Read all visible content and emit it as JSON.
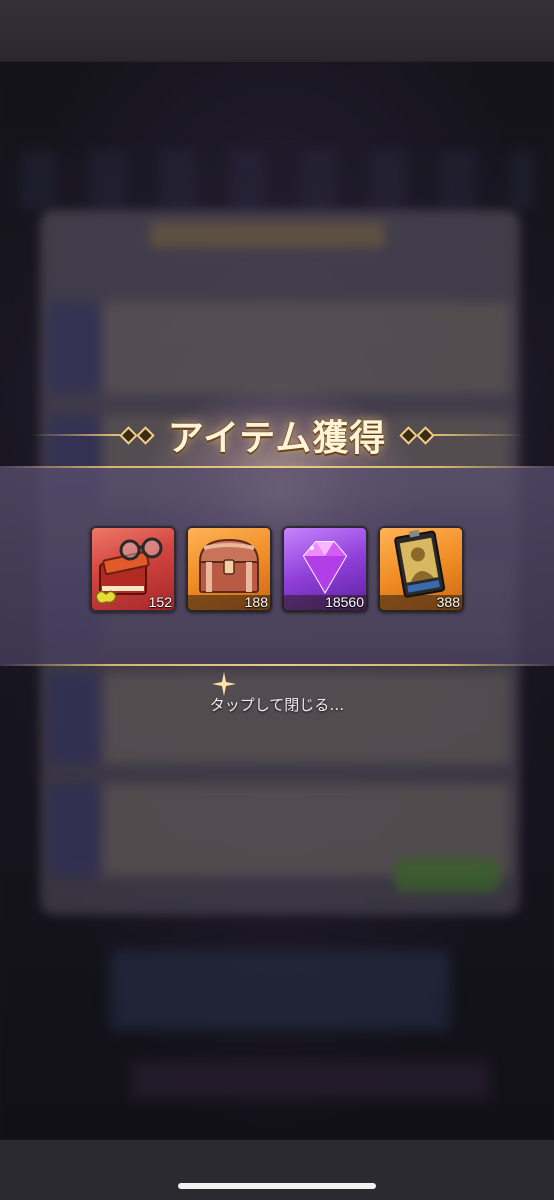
{
  "modal": {
    "title": "アイテム獲得",
    "close_hint": "タップして閉じる…"
  },
  "items": [
    {
      "icon": "glasses-books-icon",
      "count": "152",
      "frame_color": "#d0443e"
    },
    {
      "icon": "treasure-chest-icon",
      "count": "188",
      "frame_color": "#f08d24"
    },
    {
      "icon": "diamond-gem-icon",
      "count": "18560",
      "frame_color": "#8f3fd8"
    },
    {
      "icon": "photo-card-icon",
      "count": "388",
      "frame_color": "#f08d24"
    }
  ],
  "colors": {
    "title_gold": "#e5c27a",
    "band": "#584e6e"
  }
}
